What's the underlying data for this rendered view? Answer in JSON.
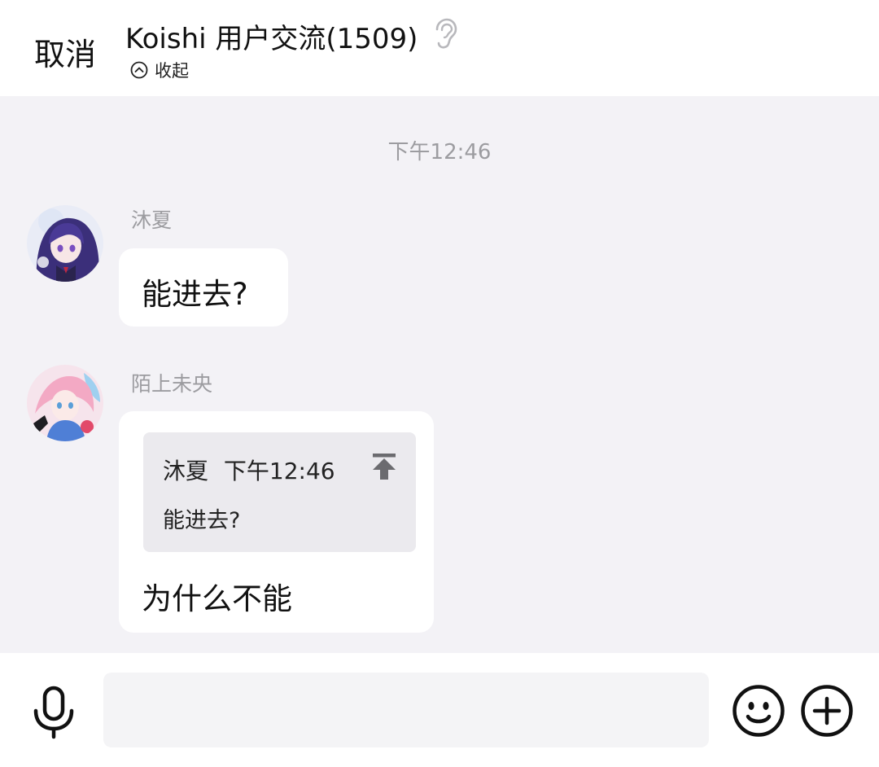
{
  "header": {
    "cancel_label": "取消",
    "title": "Koishi 用户交流(1509)",
    "collapse_label": "收起"
  },
  "chat": {
    "timestamp": "下午12:46",
    "messages": [
      {
        "sender": "沐夏",
        "avatar": "anime-girl-purple-hair-avatar",
        "text": "能进去?"
      },
      {
        "sender": "陌上未央",
        "avatar": "anime-girl-pink-hair-avatar",
        "quote": {
          "sender": "沐夏",
          "time": "下午12:46",
          "text": "能进去?"
        },
        "text": "为什么不能"
      }
    ]
  },
  "input_bar": {
    "placeholder": "",
    "value": ""
  },
  "icons": {
    "ear": "ear-icon",
    "collapse": "chevron-up-circle-icon",
    "jump": "jump-to-message-icon",
    "mic": "microphone-icon",
    "emoji": "smiley-icon",
    "plus": "plus-circle-icon"
  }
}
